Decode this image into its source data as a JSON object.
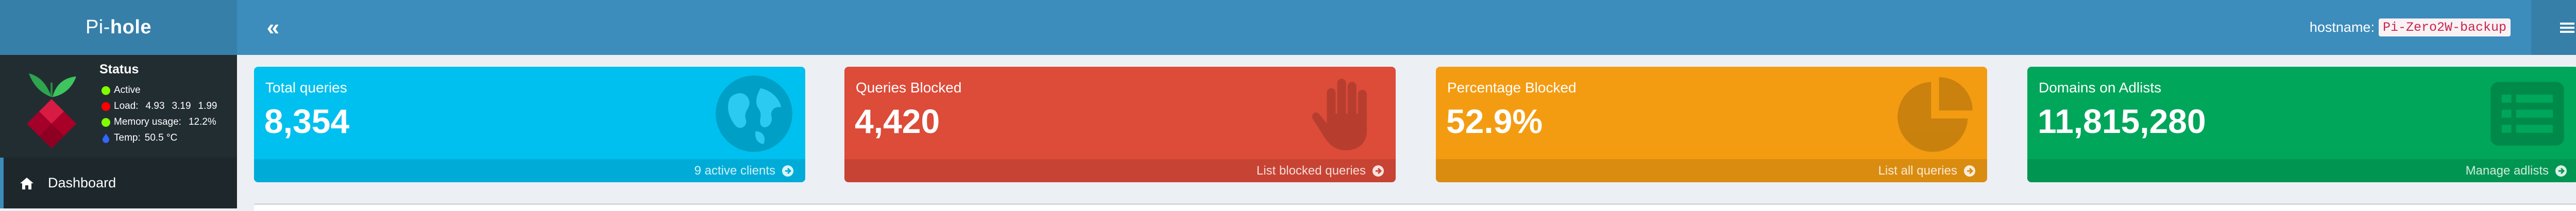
{
  "header": {
    "logo_light": "Pi-",
    "logo_bold": "hole",
    "toggle_icon": "«",
    "hostname_label": "hostname:",
    "hostname_value": "Pi-Zero2W-backup"
  },
  "sidebar": {
    "status": {
      "title": "Status",
      "active": "Active",
      "load_label": "Load:",
      "load_1": "4.93",
      "load_5": "3.19",
      "load_15": "1.99",
      "memory_label": "Memory usage:",
      "memory_value": "12.2%",
      "temp_label": "Temp:",
      "temp_value": "50.5 °C"
    },
    "items": [
      {
        "label": "Dashboard",
        "icon": "home-icon"
      }
    ]
  },
  "boxes": [
    {
      "label": "Total queries",
      "value": "8,354",
      "footer": "9 active clients",
      "icon": "globe-icon",
      "color": "#00c0ef"
    },
    {
      "label": "Queries Blocked",
      "value": "4,420",
      "footer": "List blocked queries",
      "icon": "hand-icon",
      "color": "#dd4b39"
    },
    {
      "label": "Percentage Blocked",
      "value": "52.9%",
      "footer": "List all queries",
      "icon": "pie-chart-icon",
      "color": "#f39c12"
    },
    {
      "label": "Domains on Adlists",
      "value": "11,815,280",
      "footer": "Manage adlists",
      "icon": "list-alt-icon",
      "color": "#00a65a"
    }
  ],
  "colors": {
    "navbar": "#3c8dbc",
    "logo_bar": "#367fa9",
    "sidebar": "#222d32",
    "status_ok": "#7fff00",
    "status_warn": "#ff0000",
    "temp_icon": "#3366ff"
  }
}
